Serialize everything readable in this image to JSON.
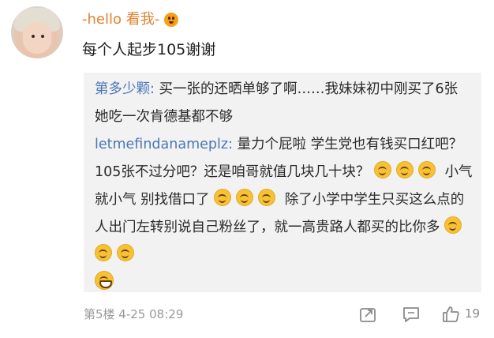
{
  "comment": {
    "username": "-hello 看我-",
    "text": "每个人起步105谢谢"
  },
  "replies": [
    {
      "author": "第多少颗",
      "separator": ": ",
      "text": "买一张的还晒单够了啊……我妹妹初中刚买了6张 她吃一次肯德基都不够"
    },
    {
      "author": "letmefindanameplz",
      "separator": ": ",
      "text_part1": "量力个屁啦 学生党也有钱买口红吧？105张不过分吧？还是咱哥就值几块几十块？",
      "text_part2": "小气就小气 别找借口了",
      "text_part3": "除了小学中学生只买这么点的人出门左转别说自己粉丝了，就一高贵路人都买的比你多"
    }
  ],
  "footer": {
    "floor_time": "第5楼 4-25 08:29",
    "like_count": "19"
  },
  "icons": {
    "share": "share-icon",
    "comment": "comment-icon",
    "like": "like-icon",
    "badge": "emoji-badge-icon"
  },
  "colors": {
    "username": "#e0822f",
    "reply_author": "#4b77b5",
    "reply_bg": "#f2f2f2",
    "meta": "#999999"
  }
}
